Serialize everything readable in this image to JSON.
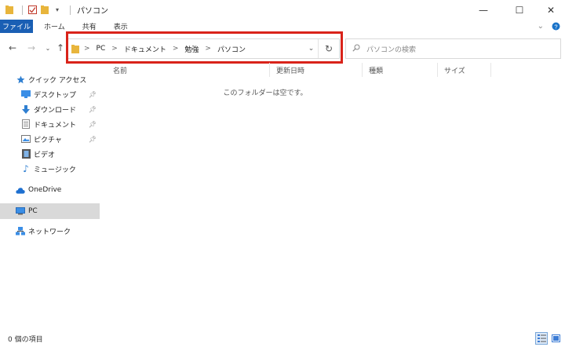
{
  "window": {
    "title": "パソコン",
    "minimize": "—",
    "maximize": "☐",
    "close": "✕"
  },
  "ribbon": {
    "file": "ファイル",
    "tabs": [
      "ホーム",
      "共有",
      "表示"
    ]
  },
  "address": {
    "crumbs": [
      "PC",
      "ドキュメント",
      "勉強",
      "パソコン"
    ],
    "separator": ">"
  },
  "search": {
    "placeholder": "パソコンの検索"
  },
  "sidebar": {
    "items": [
      {
        "label": "クイック アクセス",
        "icon": "star-icon",
        "pinned": false
      },
      {
        "label": "デスクトップ",
        "icon": "desktop-icon",
        "pinned": true
      },
      {
        "label": "ダウンロード",
        "icon": "download-icon",
        "pinned": true
      },
      {
        "label": "ドキュメント",
        "icon": "document-icon",
        "pinned": true
      },
      {
        "label": "ピクチャ",
        "icon": "picture-icon",
        "pinned": true
      },
      {
        "label": "ビデオ",
        "icon": "video-icon",
        "pinned": false
      },
      {
        "label": "ミュージック",
        "icon": "music-icon",
        "pinned": false
      },
      {
        "label": "OneDrive",
        "icon": "cloud-icon",
        "pinned": false
      },
      {
        "label": "PC",
        "icon": "pc-icon",
        "pinned": false,
        "selected": true
      },
      {
        "label": "ネットワーク",
        "icon": "network-icon",
        "pinned": false
      }
    ]
  },
  "columns": [
    "名前",
    "更新日時",
    "種類",
    "サイズ"
  ],
  "content": {
    "empty_message": "このフォルダーは空です。"
  },
  "status": {
    "item_count": "0 個の項目"
  },
  "colors": {
    "file_tab": "#1a5fb4",
    "highlight": "#d9231a",
    "folder": "#e8b53c",
    "selected_bg": "#d9d9d9"
  }
}
